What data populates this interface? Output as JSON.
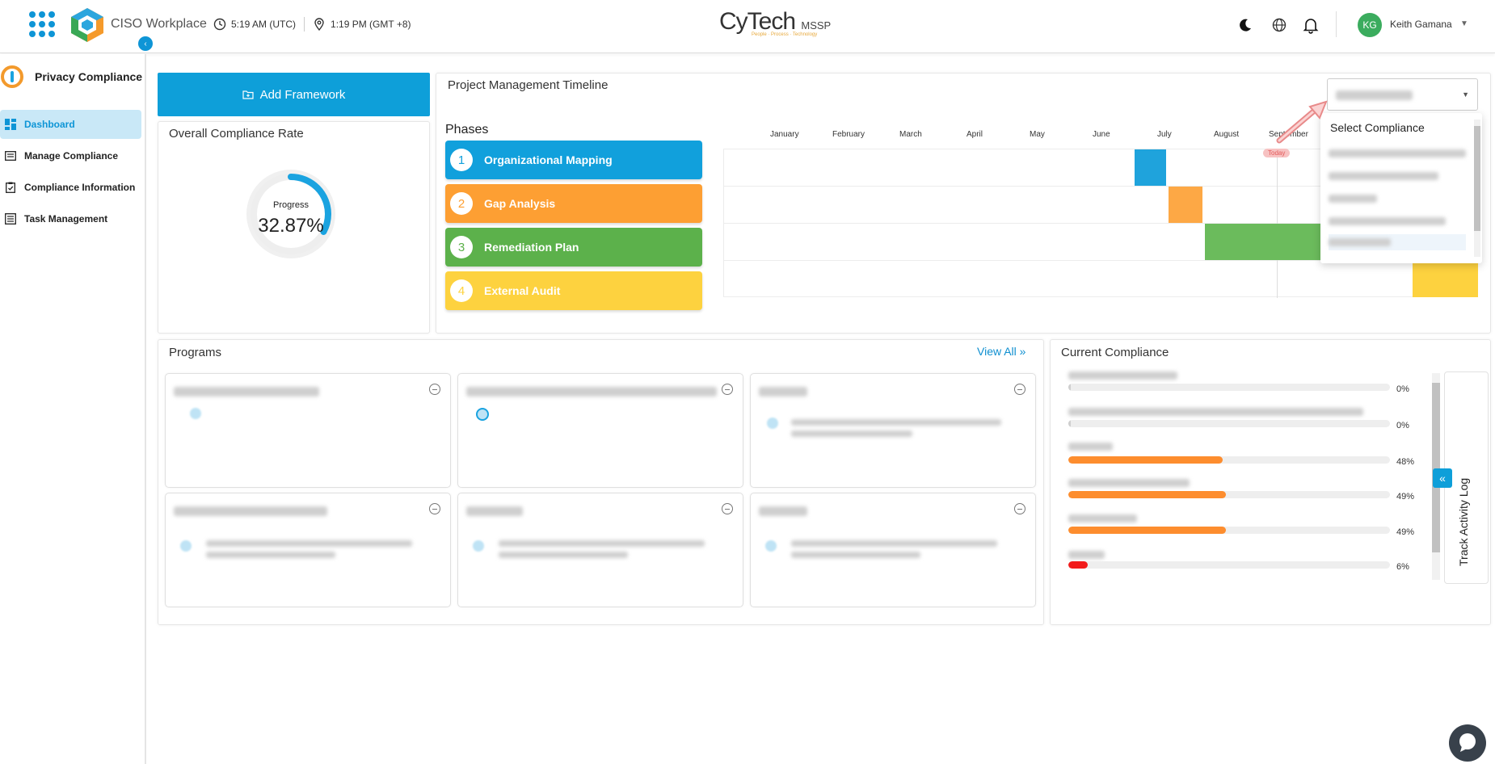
{
  "header": {
    "app_title": "CISO Workplace",
    "utc_time": "5:19 AM (UTC)",
    "local_time": "1:19 PM (GMT +8)",
    "brand": "CyTech",
    "brand_suffix": "MSSP",
    "brand_tagline": "People · Process · Technology",
    "user_initials": "KG",
    "user_name": "Keith Gamana"
  },
  "sidebar": {
    "title": "Privacy Compliance",
    "items": [
      {
        "label": "Dashboard",
        "active": true
      },
      {
        "label": "Manage Compliance"
      },
      {
        "label": "Compliance Information"
      },
      {
        "label": "Task Management"
      }
    ]
  },
  "add_framework": {
    "label": "Add Framework"
  },
  "overall": {
    "title": "Overall Compliance Rate",
    "progress_label": "Progress",
    "progress_value": "32.87%",
    "progress_fraction": 0.3287,
    "color": "#1aa3e0"
  },
  "timeline": {
    "title": "Project Management Timeline",
    "phases_title": "Phases",
    "phases": [
      {
        "num": "1",
        "label": "Organizational Mapping",
        "color": "#11a0dc"
      },
      {
        "num": "2",
        "label": "Gap Analysis",
        "color": "#fd9f33"
      },
      {
        "num": "3",
        "label": "Remediation Plan",
        "color": "#5cb14b"
      },
      {
        "num": "4",
        "label": "External Audit",
        "color": "#fdd23f"
      }
    ],
    "months": [
      "January",
      "February",
      "March",
      "April",
      "May",
      "June",
      "July",
      "August",
      "September"
    ],
    "today_label": "Today",
    "select_placeholder": "Select Compliance"
  },
  "programs": {
    "title": "Programs",
    "view_all": "View All"
  },
  "current_compliance": {
    "title": "Current Compliance",
    "items": [
      {
        "pct": "0%",
        "value": 0,
        "color": "#fd8d2e"
      },
      {
        "pct": "0%",
        "value": 0,
        "color": "#fd8d2e"
      },
      {
        "pct": "48%",
        "value": 48,
        "color": "#fd8d2e"
      },
      {
        "pct": "49%",
        "value": 49,
        "color": "#fd8d2e"
      },
      {
        "pct": "49%",
        "value": 49,
        "color": "#fd8d2e"
      },
      {
        "pct": "6%",
        "value": 6,
        "color": "#f21b1b"
      }
    ],
    "track_log": "Track Activity Log"
  }
}
